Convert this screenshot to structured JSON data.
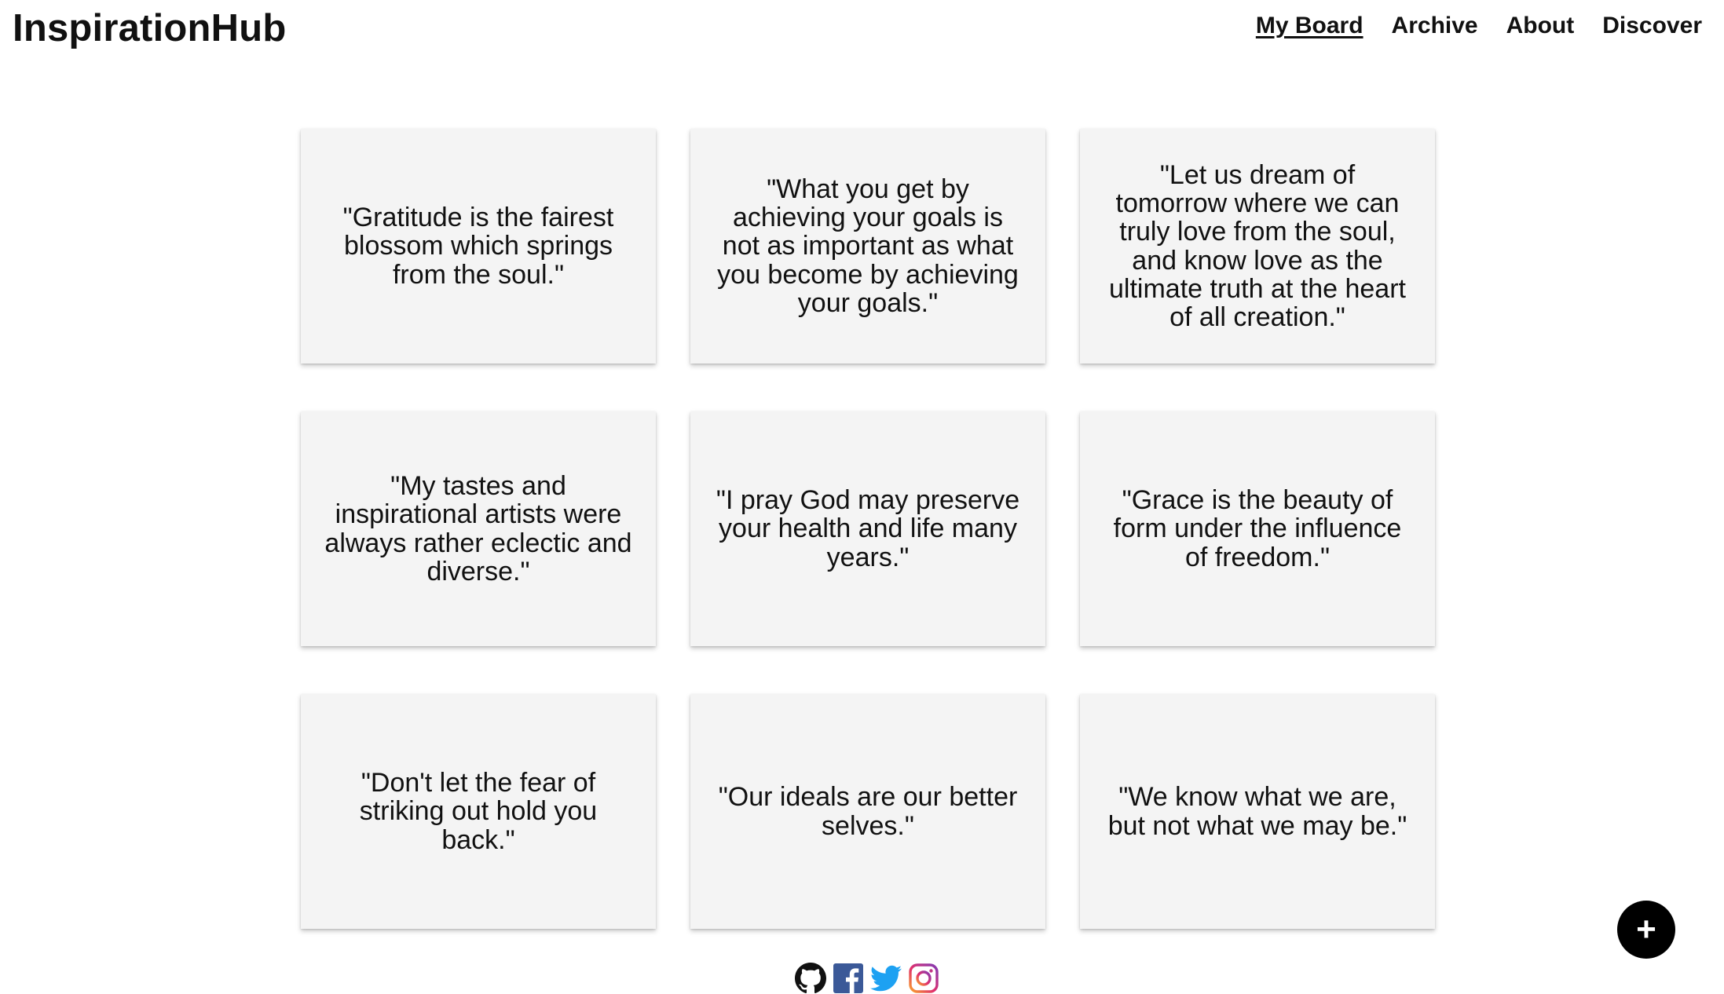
{
  "header": {
    "brand": "InspirationHub",
    "nav": [
      {
        "label": "My Board",
        "active": true
      },
      {
        "label": "Archive",
        "active": false
      },
      {
        "label": "About",
        "active": false
      },
      {
        "label": "Discover",
        "active": false
      }
    ]
  },
  "board": {
    "quotes": [
      "\"Gratitude is the fairest blossom which springs from the soul.\"",
      "\"What you get by achieving your goals is not as important as what you become by achieving your goals.\"",
      "\"Let us dream of tomorrow where we can truly love from the soul, and know love as the ultimate truth at the heart of all creation.\"",
      "\"My tastes and inspirational artists were always rather eclectic and diverse.\"",
      "\"I pray God may preserve your health and life many years.\"",
      "\"Grace is the beauty of form under the influence of freedom.\"",
      "\"Don't let the fear of striking out hold you back.\"",
      "\"Our ideals are our better selves.\"",
      "\"We know what we are, but not what we may be.\""
    ]
  },
  "footer": {
    "social_icons": [
      "github-icon",
      "facebook-icon",
      "twitter-icon",
      "instagram-icon"
    ]
  },
  "fab": {
    "label": "+"
  },
  "colors": {
    "card_background": "#f4f4f4",
    "fab_background": "#000000",
    "facebook": "#3b5998",
    "twitter": "#1da1f2"
  }
}
